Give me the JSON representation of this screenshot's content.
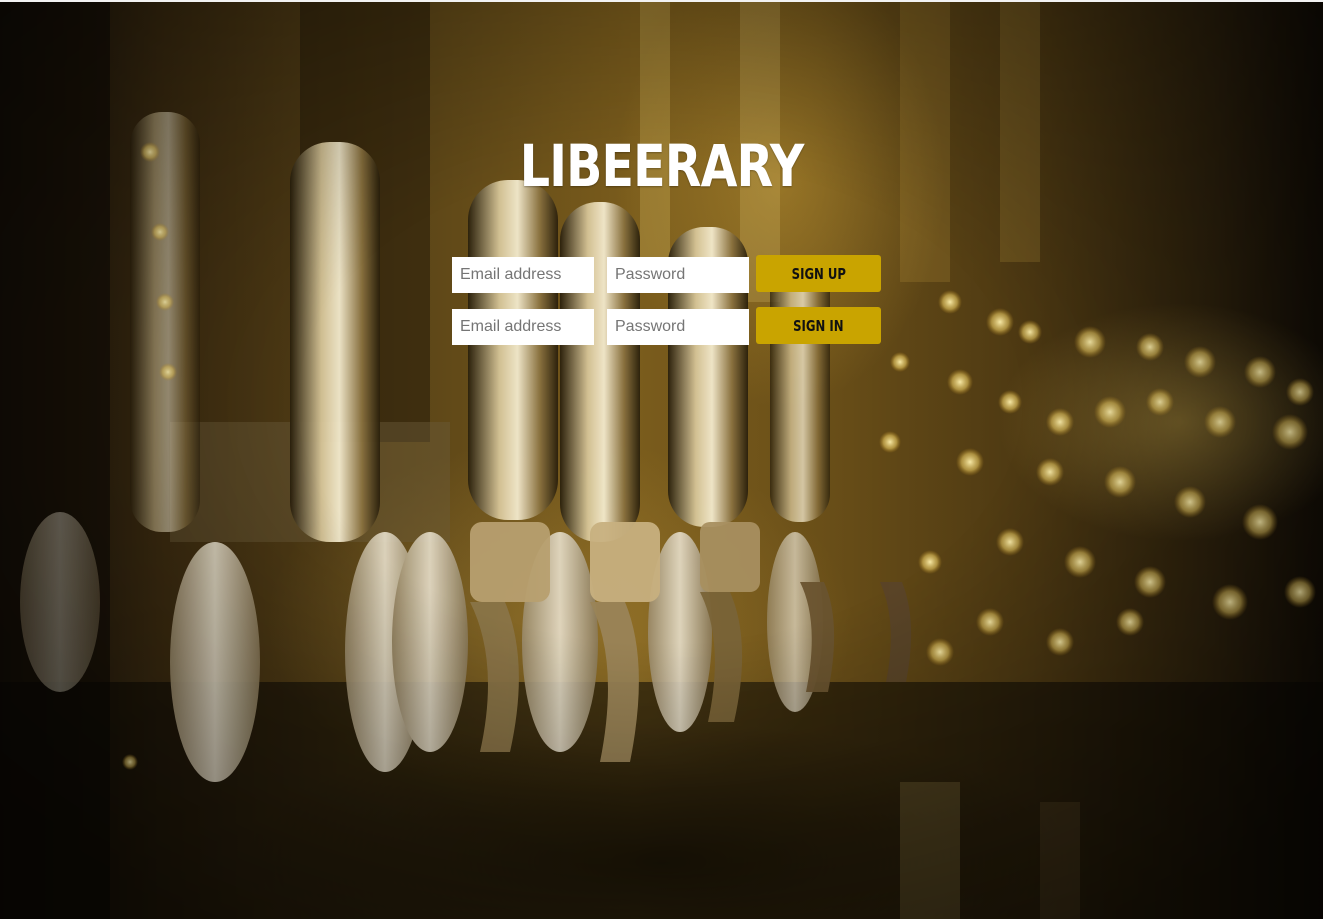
{
  "app": {
    "logo_text": "LIBEERARY"
  },
  "signup": {
    "email_placeholder": "Email address",
    "password_placeholder": "Password",
    "button_label": "SIGN UP"
  },
  "signin": {
    "email_placeholder": "Email address",
    "password_placeholder": "Password",
    "button_label": "SIGN IN"
  },
  "colors": {
    "accent": "#c9a400",
    "logo": "#ffffff",
    "field_background": "#ffffff"
  },
  "background": {
    "image_subject": "beer-taps-photo"
  }
}
